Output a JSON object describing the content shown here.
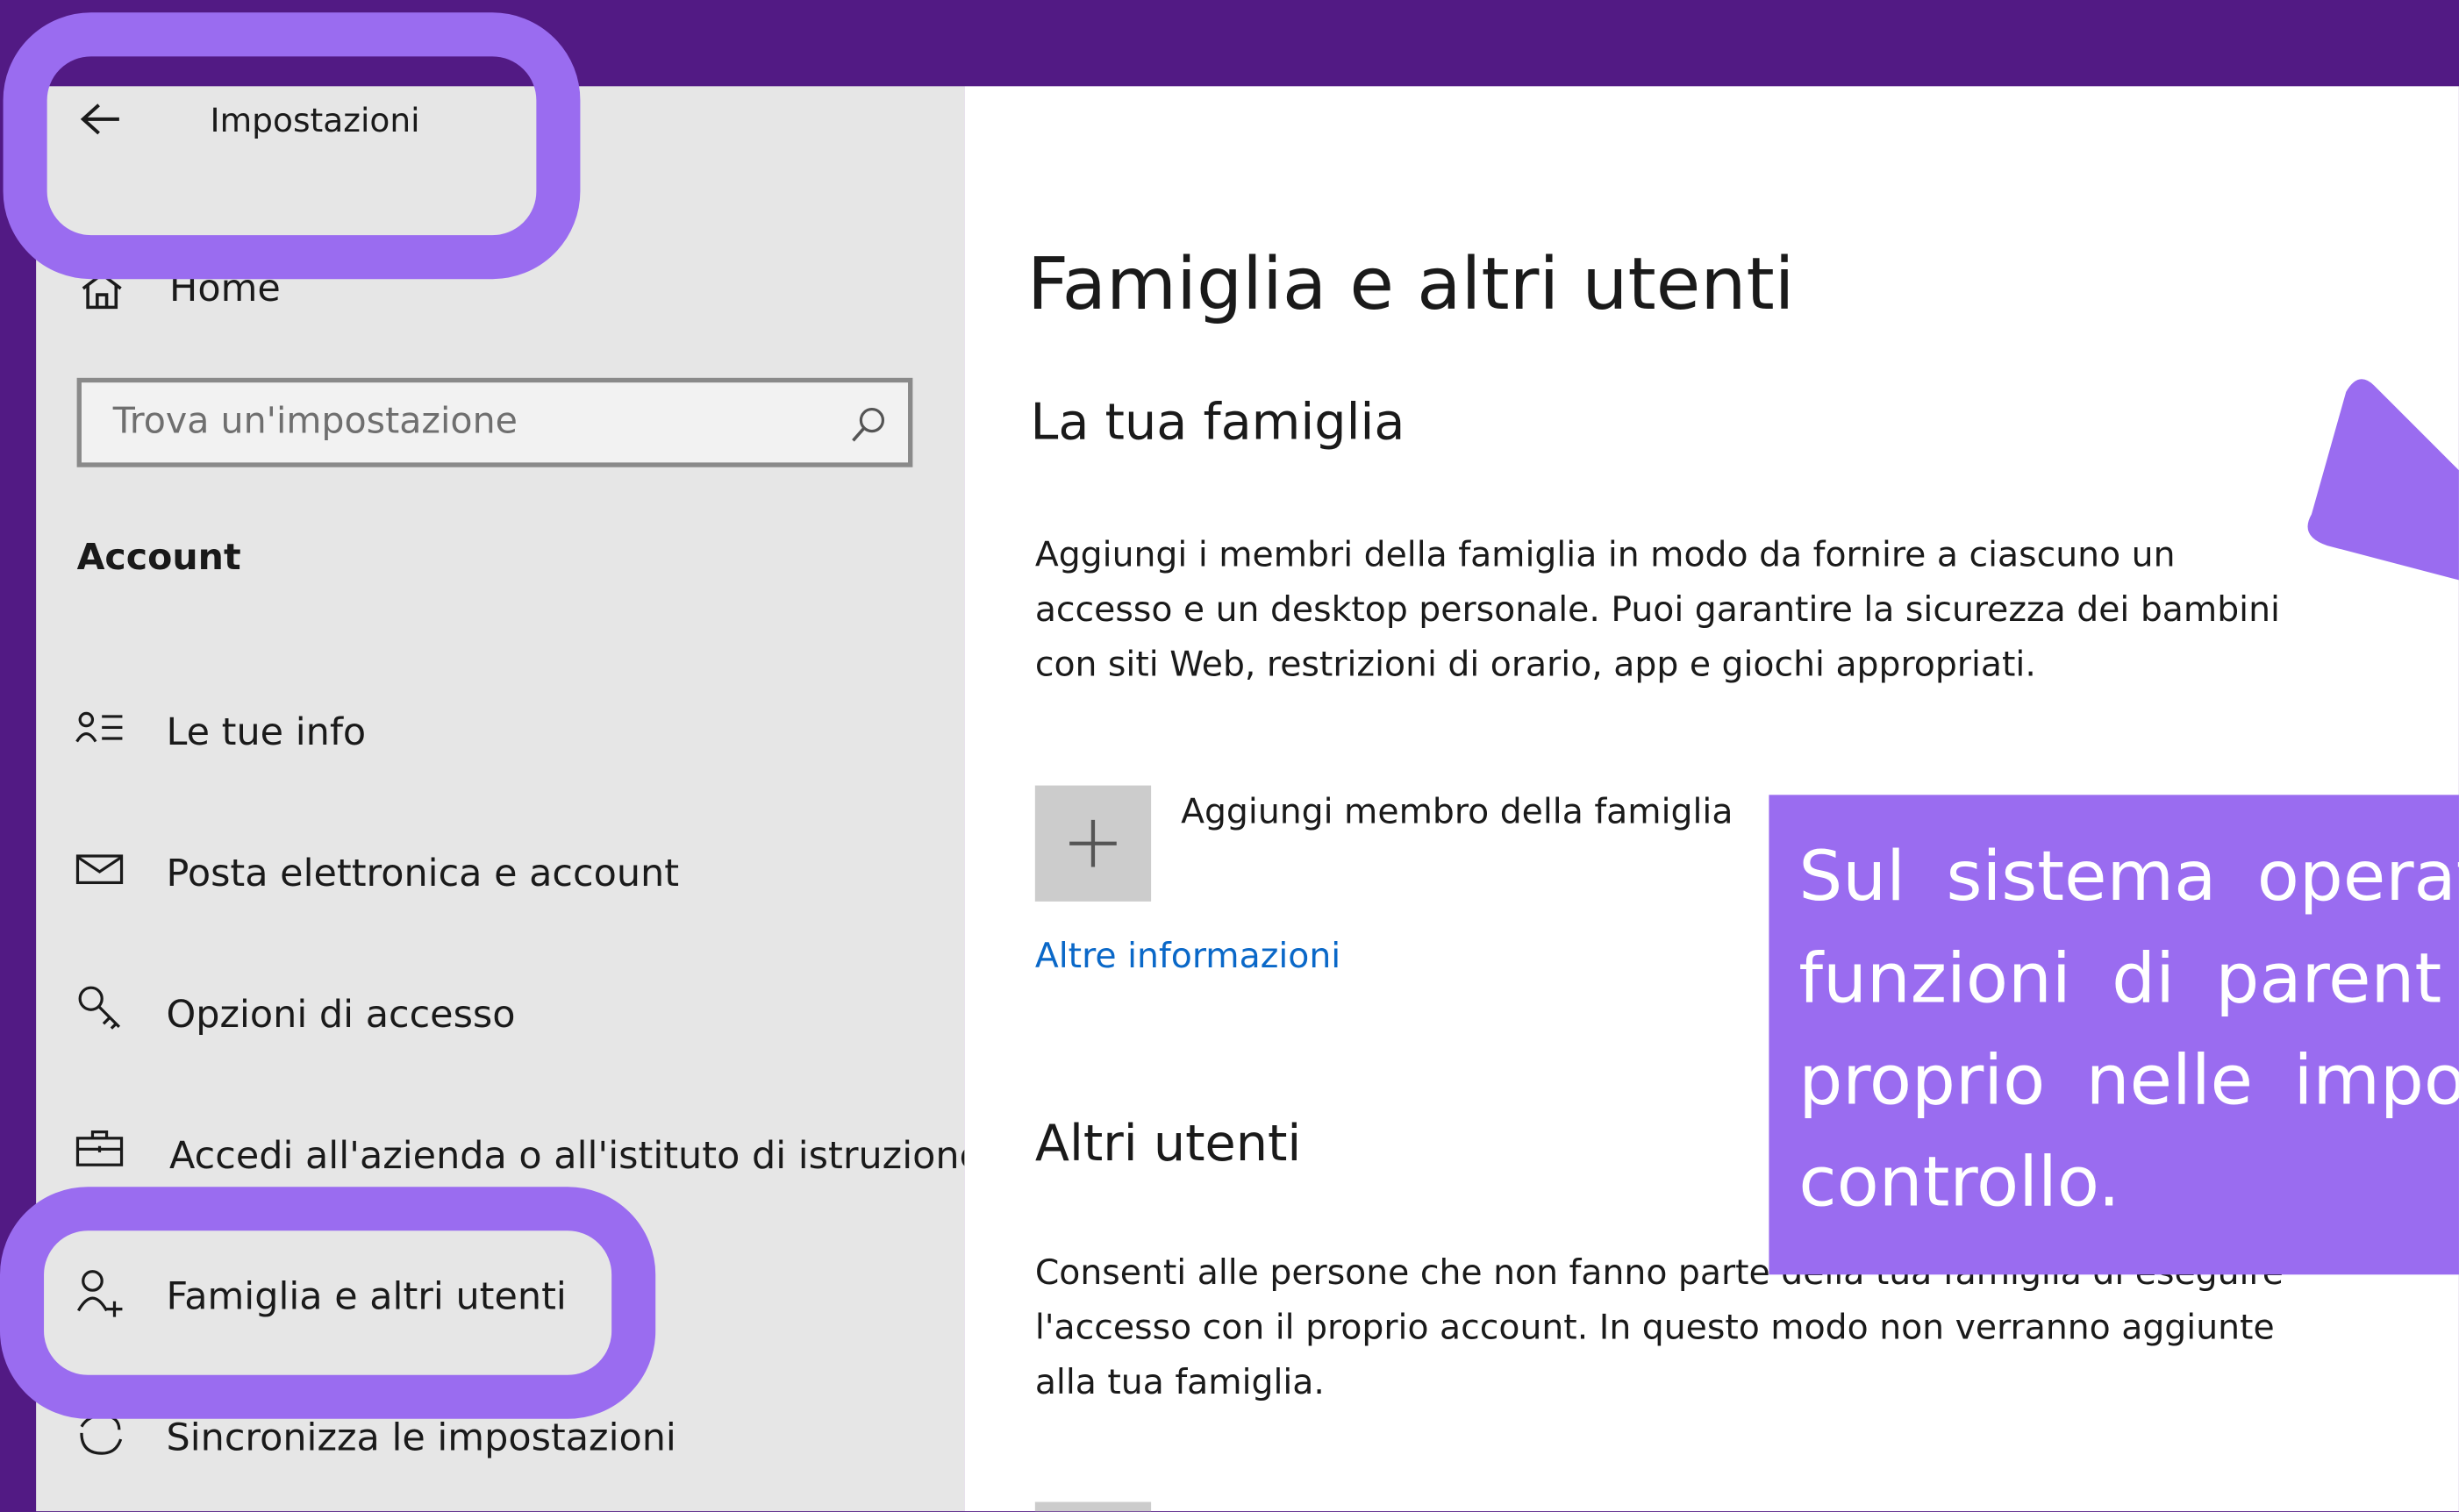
{
  "window": {
    "title": "Impostazioni",
    "back_icon": "back-arrow-icon"
  },
  "sidebar": {
    "home_label": "Home",
    "search": {
      "placeholder": "Trova un'impostazione",
      "icon": "search-icon"
    },
    "section_title": "Account",
    "items": [
      {
        "label": "Le tue info",
        "icon": "person-info-icon"
      },
      {
        "label": "Posta elettronica e account",
        "icon": "mail-icon"
      },
      {
        "label": "Opzioni di accesso",
        "icon": "key-icon"
      },
      {
        "label": "Accedi all'azienda o all'istituto di istruzione",
        "icon": "briefcase-icon"
      },
      {
        "label": "Famiglia e altri utenti",
        "icon": "person-add-icon",
        "selected": true
      },
      {
        "label": "Sincronizza le impostazioni",
        "icon": "sync-icon"
      }
    ]
  },
  "main": {
    "page_title": "Famiglia e altri utenti",
    "family_section": {
      "title": "La tua famiglia",
      "description_lines": [
        "Aggiungi i membri della famiglia in modo da fornire a ciascuno un",
        "accesso e un desktop personale. Puoi garantire la sicurezza dei bambini",
        "con siti Web, restrizioni di orario, app e giochi appropriati."
      ],
      "add_button_icon": "plus-icon",
      "add_label": "Aggiungi membro della famiglia",
      "more_info_link": "Altre informazioni"
    },
    "others_section": {
      "title": "Altri utenti",
      "description_lines": [
        "Consenti alle persone che non fanno parte della tua famiglia di eseguire",
        "l'accesso con il proprio account. In questo modo non verranno aggiunte",
        "alla tua famiglia."
      ]
    }
  },
  "callout": {
    "lines": [
      "Sul sistema operativ",
      "funzioni di parent",
      "proprio nelle impos",
      "controllo."
    ]
  },
  "colors": {
    "frame_purple": "#521a84",
    "highlight_purple": "#9a6cf0",
    "sidebar_bg": "#e6e6e6",
    "link_blue": "#0a68c8"
  }
}
